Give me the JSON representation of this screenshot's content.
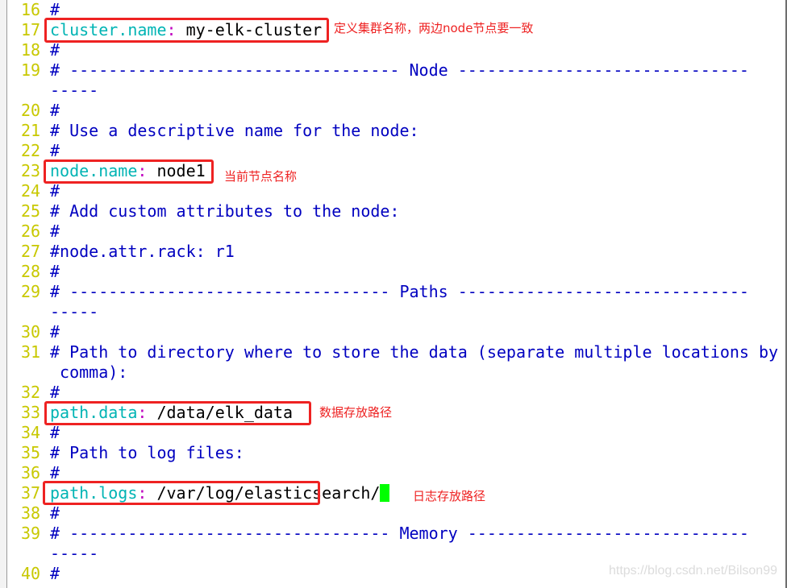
{
  "editor": {
    "lines": [
      {
        "n": "16",
        "text": "#"
      },
      {
        "n": "17",
        "key": "cluster.name",
        "value": "my-elk-cluster"
      },
      {
        "n": "18",
        "text": "#"
      },
      {
        "n": "19",
        "text": "# ---------------------------------- Node ------------------------------",
        "wrap": "-----"
      },
      {
        "n": "20",
        "text": "#"
      },
      {
        "n": "21",
        "text": "# Use a descriptive name for the node:"
      },
      {
        "n": "22",
        "text": "#"
      },
      {
        "n": "23",
        "key": "node.name",
        "value": "node1"
      },
      {
        "n": "24",
        "text": "#"
      },
      {
        "n": "25",
        "text": "# Add custom attributes to the node:"
      },
      {
        "n": "26",
        "text": "#"
      },
      {
        "n": "27",
        "text": "#node.attr.rack: r1"
      },
      {
        "n": "28",
        "text": "#"
      },
      {
        "n": "29",
        "text": "# --------------------------------- Paths ------------------------------",
        "wrap": "-----"
      },
      {
        "n": "30",
        "text": "#"
      },
      {
        "n": "31",
        "text": "# Path to directory where to store the data (separate multiple locations by",
        "wrap": " comma):"
      },
      {
        "n": "32",
        "text": "#"
      },
      {
        "n": "33",
        "key": "path.data",
        "value": "/data/elk_data"
      },
      {
        "n": "34",
        "text": "#"
      },
      {
        "n": "35",
        "text": "# Path to log files:"
      },
      {
        "n": "36",
        "text": "#"
      },
      {
        "n": "37",
        "key": "path.logs",
        "value": "/var/log/elasticsearch/"
      },
      {
        "n": "38",
        "text": "#"
      },
      {
        "n": "39",
        "text": "# --------------------------------- Memory -----------------------------",
        "wrap": "-----"
      },
      {
        "n": "40",
        "text": "#"
      }
    ]
  },
  "annotations": {
    "cluster_name": "定义集群名称，两边node节点要一致",
    "node_name": "当前节点名称",
    "path_data": "数据存放路径",
    "path_logs": "日志存放路径"
  },
  "watermark": "https://blog.csdn.net/Bilson99",
  "colors": {
    "line_number": "#c8c800",
    "comment": "#0000c0",
    "key": "#00b4b4",
    "colon": "#c000c0",
    "cursor": "#00ff00",
    "annotation": "#ee2222"
  }
}
